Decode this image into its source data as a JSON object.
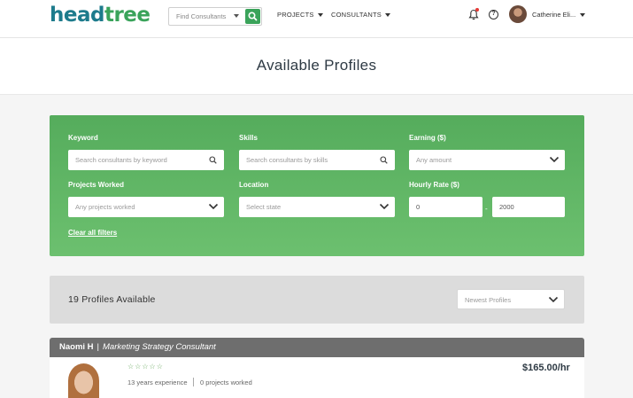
{
  "header": {
    "logo_head": "head",
    "logo_tree": "tree",
    "search_placeholder": "Find Consultants",
    "nav": [
      {
        "label": "PROJECTS"
      },
      {
        "label": "CONSULTANTS"
      }
    ],
    "user_name": "Catherine Eli..."
  },
  "page": {
    "title": "Available Profiles"
  },
  "filters": {
    "keyword": {
      "label": "Keyword",
      "placeholder": "Search consultants by keyword"
    },
    "skills": {
      "label": "Skills",
      "placeholder": "Search consultants by skills"
    },
    "earning": {
      "label": "Earning ($)",
      "value": "Any amount"
    },
    "projects_worked": {
      "label": "Projects Worked",
      "value": "Any projects worked"
    },
    "location": {
      "label": "Location",
      "value": "Select state"
    },
    "hourly_rate": {
      "label": "Hourly Rate ($)",
      "min": "0",
      "separator": "-",
      "max": "2000"
    },
    "clear_label": "Clear all filters"
  },
  "results": {
    "count_label": "19 Profiles Available",
    "sort_value": "Newest Profiles"
  },
  "profiles": [
    {
      "name": "Naomi H",
      "separator": "|",
      "role": "Marketing Strategy Consultant",
      "stars": "☆☆☆☆☆",
      "experience": "13 years experience",
      "projects": "0 projects worked",
      "rate": "$165.00/hr"
    }
  ],
  "colors": {
    "brand_green": "#3aa35a",
    "brand_teal": "#1d7b8c",
    "filter_panel": "#5cb562",
    "card_header": "#6e6e6e"
  },
  "icons": {
    "search": "search-icon",
    "bell": "bell-icon",
    "help": "question-circle-icon",
    "chevron": "chevron-down-icon"
  }
}
